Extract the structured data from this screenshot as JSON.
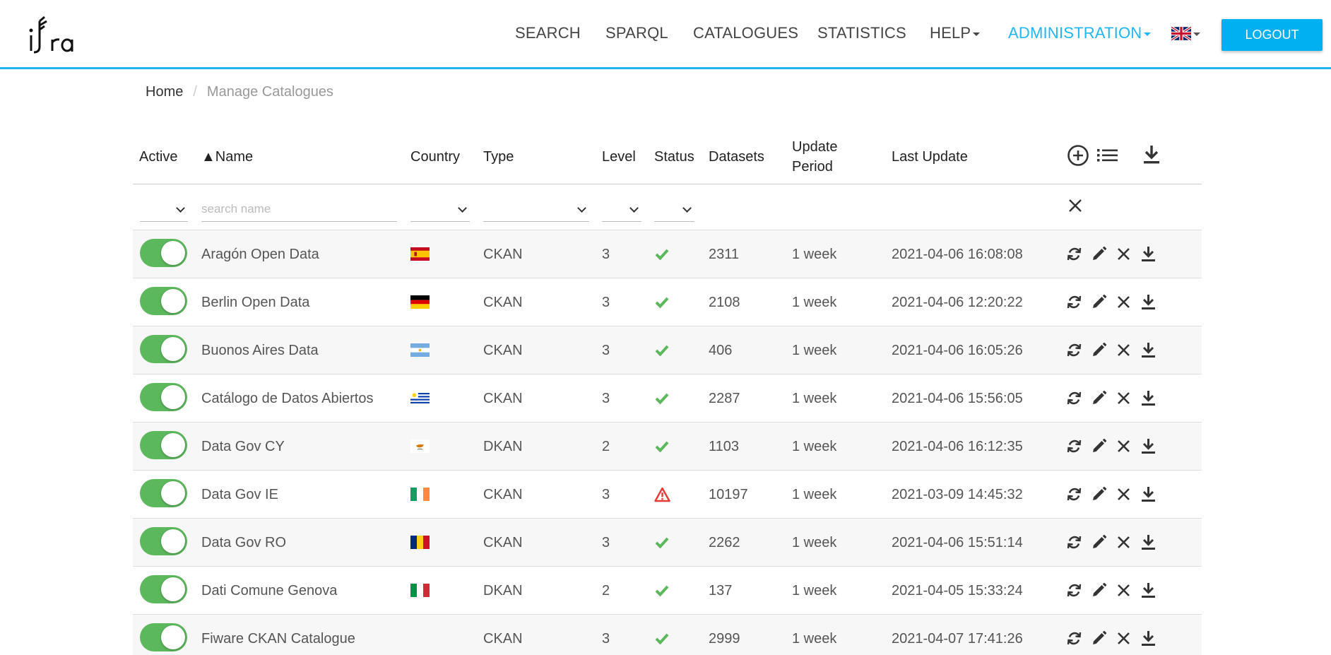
{
  "nav": {
    "items": [
      "SEARCH",
      "SPARQL",
      "CATALOGUES",
      "STATISTICS",
      "HELP",
      "ADMINISTRATION"
    ],
    "logout_label": "LOGOUT",
    "accent": "#1fb6f0"
  },
  "breadcrumb": {
    "home": "Home",
    "separator": "/",
    "current": "Manage Catalogues"
  },
  "table": {
    "headers": {
      "active": "Active",
      "name": "▲Name",
      "country": "Country",
      "type": "Type",
      "level": "Level",
      "status": "Status",
      "datasets": "Datasets",
      "update_period_1": "Update",
      "update_period_2": "Period",
      "last_update": "Last Update"
    },
    "search_placeholder": "search name",
    "rows": [
      {
        "name": "Aragón Open Data",
        "country": "es",
        "type": "CKAN",
        "level": "3",
        "status": "ok",
        "datasets": "2311",
        "period": "1 week",
        "last_update": "2021-04-06 16:08:08",
        "active": true
      },
      {
        "name": "Berlin Open Data",
        "country": "de",
        "type": "CKAN",
        "level": "3",
        "status": "ok",
        "datasets": "2108",
        "period": "1 week",
        "last_update": "2021-04-06 12:20:22",
        "active": true
      },
      {
        "name": "Buonos Aires Data",
        "country": "ar",
        "type": "CKAN",
        "level": "3",
        "status": "ok",
        "datasets": "406",
        "period": "1 week",
        "last_update": "2021-04-06 16:05:26",
        "active": true
      },
      {
        "name": "Catálogo de Datos Abiertos",
        "country": "uy",
        "type": "CKAN",
        "level": "3",
        "status": "ok",
        "datasets": "2287",
        "period": "1 week",
        "last_update": "2021-04-06 15:56:05",
        "active": true
      },
      {
        "name": "Data Gov CY",
        "country": "cy",
        "type": "DKAN",
        "level": "2",
        "status": "ok",
        "datasets": "1103",
        "period": "1 week",
        "last_update": "2021-04-06 16:12:35",
        "active": true
      },
      {
        "name": "Data Gov IE",
        "country": "ie",
        "type": "CKAN",
        "level": "3",
        "status": "warning",
        "datasets": "10197",
        "period": "1 week",
        "last_update": "2021-03-09 14:45:32",
        "active": true
      },
      {
        "name": "Data Gov RO",
        "country": "ro",
        "type": "CKAN",
        "level": "3",
        "status": "ok",
        "datasets": "2262",
        "period": "1 week",
        "last_update": "2021-04-06 15:51:14",
        "active": true
      },
      {
        "name": "Dati Comune Genova",
        "country": "it",
        "type": "DKAN",
        "level": "2",
        "status": "ok",
        "datasets": "137",
        "period": "1 week",
        "last_update": "2021-04-05 15:33:24",
        "active": true
      },
      {
        "name": "Fiware CKAN Catalogue",
        "country": "",
        "type": "CKAN",
        "level": "3",
        "status": "ok",
        "datasets": "2999",
        "period": "1 week",
        "last_update": "2021-04-07 17:41:26",
        "active": true
      }
    ]
  },
  "colors": {
    "toggle_on": "#5cb85c",
    "status_ok": "#5cb85c",
    "status_warning": "#e53935",
    "logout_bg": "#00b0f0"
  }
}
